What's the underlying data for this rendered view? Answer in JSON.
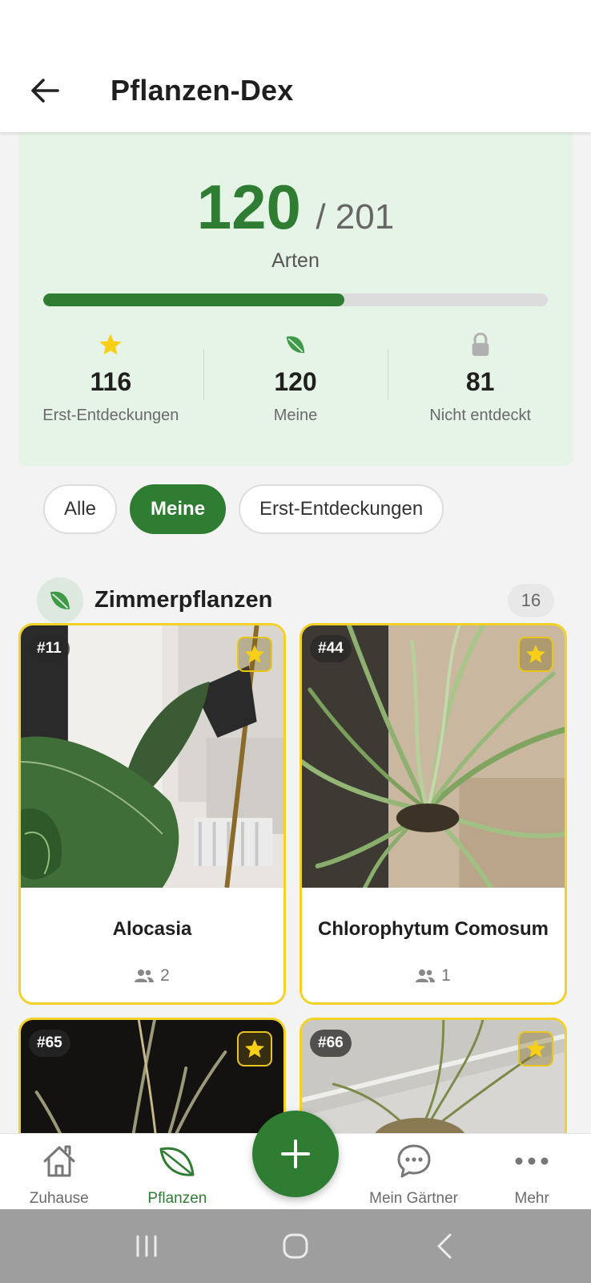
{
  "header": {
    "title": "Pflanzen-Dex"
  },
  "summary": {
    "discovered": "120",
    "total_label": "/ 201",
    "unit_label": "Arten",
    "progress_fraction": 0.597,
    "stats": [
      {
        "icon": "star-icon",
        "value": "116",
        "label": "Erst-Entdeckungen"
      },
      {
        "icon": "leaf-icon",
        "value": "120",
        "label": "Meine"
      },
      {
        "icon": "lock-icon",
        "value": "81",
        "label": "Nicht entdeckt"
      }
    ]
  },
  "filters": [
    {
      "label": "Alle",
      "active": false
    },
    {
      "label": "Meine",
      "active": true
    },
    {
      "label": "Erst-Entdeckungen",
      "active": false
    }
  ],
  "section": {
    "title": "Zimmerpflanzen",
    "count": "16"
  },
  "cards": [
    {
      "number": "#11",
      "name": "Alocasia",
      "people": "2"
    },
    {
      "number": "#44",
      "name": "Chlorophytum Comosum",
      "people": "1"
    },
    {
      "number": "#65"
    },
    {
      "number": "#66"
    }
  ],
  "nav": {
    "items": [
      {
        "label": "Zuhause",
        "icon": "home-icon"
      },
      {
        "label": "Pflanzen",
        "icon": "leaf-icon",
        "active": true
      },
      {
        "label": "Mein Gärtner",
        "icon": "chat-icon"
      },
      {
        "label": "Mehr",
        "icon": "more-icon"
      }
    ],
    "fab_icon": "plus-icon"
  },
  "colors": {
    "accent": "#2e7d32",
    "summary_bg": "#e6f4e7",
    "card_border": "#f2d227",
    "star": "#f7cf16"
  }
}
